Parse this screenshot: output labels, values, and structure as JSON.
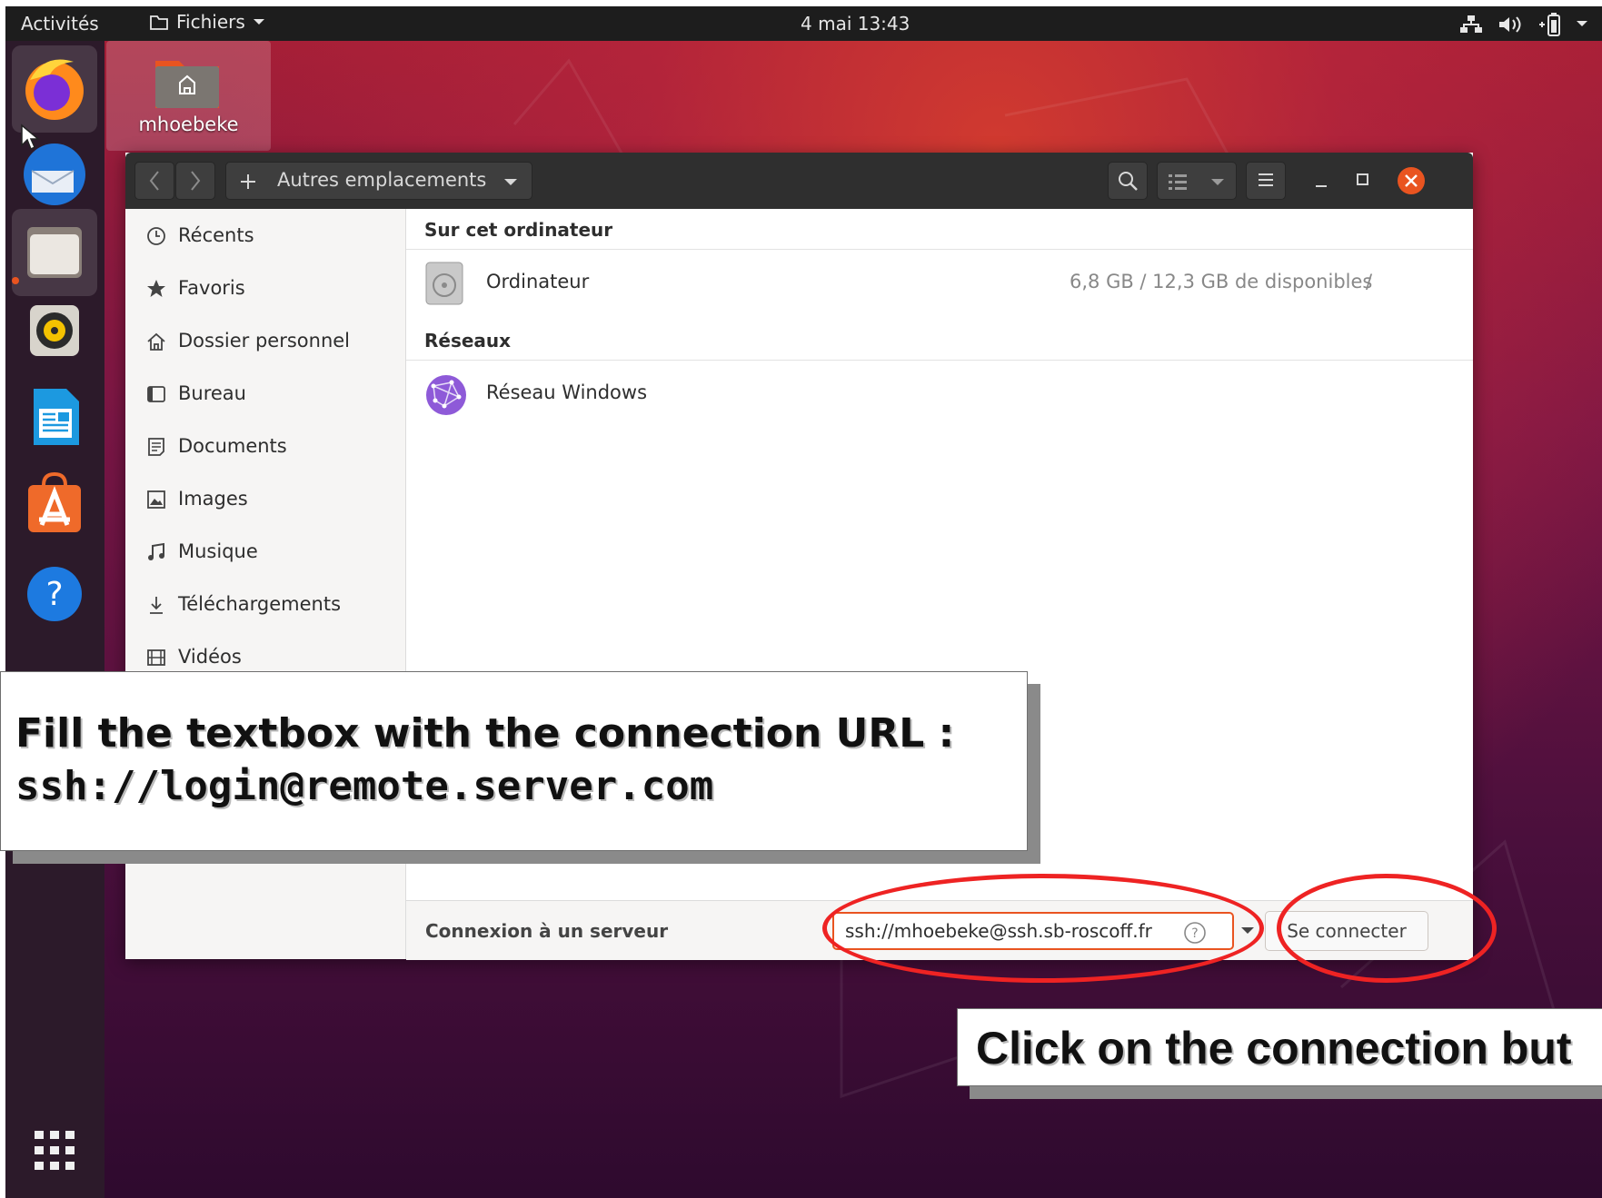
{
  "topbar": {
    "activities": "Activités",
    "app_menu": "Fichiers",
    "clock": "4 mai  13:43"
  },
  "desktop": {
    "home_icon_label": "mhoebeke"
  },
  "window": {
    "location_label": "Autres emplacements",
    "sidebar": [
      {
        "label": "Récents",
        "icon": "clock-icon"
      },
      {
        "label": "Favoris",
        "icon": "star-icon"
      },
      {
        "label": "Dossier personnel",
        "icon": "home-icon"
      },
      {
        "label": "Bureau",
        "icon": "desktop-icon"
      },
      {
        "label": "Documents",
        "icon": "document-icon"
      },
      {
        "label": "Images",
        "icon": "image-icon"
      },
      {
        "label": "Musique",
        "icon": "music-icon"
      },
      {
        "label": "Téléchargements",
        "icon": "download-icon"
      },
      {
        "label": "Vidéos",
        "icon": "video-icon"
      }
    ],
    "sections": {
      "computer_heading": "Sur cet ordinateur",
      "computer_name": "Ordinateur",
      "computer_space": "6,8 GB / 12,3 GB de disponibles",
      "computer_mount": "/",
      "network_heading": "Réseaux",
      "network_name": "Réseau Windows"
    },
    "connect": {
      "label": "Connexion à un serveur",
      "url_value": "ssh://mhoebeke@ssh.sb-roscoff.fr",
      "button": "Se connecter"
    }
  },
  "annotations": {
    "fill_line1": "Fill the textbox with the connection URL :",
    "fill_line2": "ssh://login@remote.server.com",
    "click_text": "Click on the connection but",
    "highlight_color": "#ee2323"
  }
}
